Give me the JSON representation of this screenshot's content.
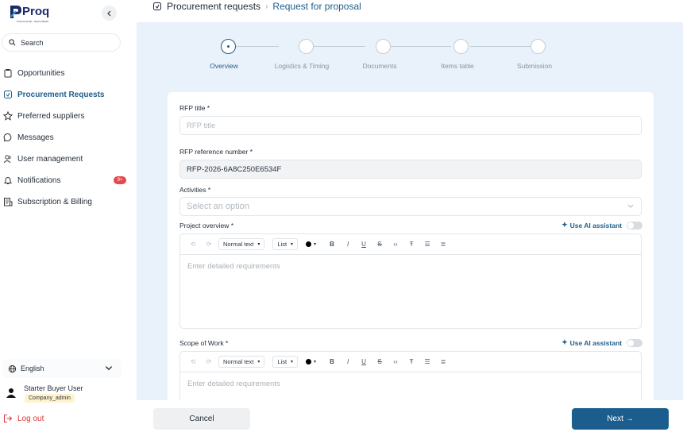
{
  "brand": {
    "name": "Proq",
    "tagline": "Procure Smart · Source Better"
  },
  "sidebar": {
    "search_label": "Search",
    "items": [
      {
        "label": "Opportunities",
        "icon": "clipboard-icon",
        "active": false
      },
      {
        "label": "Procurement Requests",
        "icon": "request-icon",
        "active": true
      },
      {
        "label": "Preferred suppliers",
        "icon": "star-icon",
        "active": false
      },
      {
        "label": "Messages",
        "icon": "chat-icon",
        "active": false
      },
      {
        "label": "User management",
        "icon": "users-icon",
        "active": false
      },
      {
        "label": "Notifications",
        "icon": "bell-icon",
        "active": false,
        "badge": "9+"
      },
      {
        "label": "Subscription & Billing",
        "icon": "billing-icon",
        "active": false
      }
    ],
    "language": "English",
    "user": {
      "name": "Starter Buyer User",
      "role": "Company_admin"
    },
    "logout_label": "Log out"
  },
  "breadcrumb": {
    "parent": "Procurement requests",
    "current": "Request for proposal"
  },
  "stepper": {
    "steps": [
      "Overview",
      "Logistics & Timing",
      "Documents",
      "Items table",
      "Submission"
    ],
    "active_index": 0
  },
  "form": {
    "rfp_title": {
      "label": "RFP title *",
      "placeholder": "RFP title"
    },
    "rfp_ref": {
      "label": "RFP reference number *",
      "value": "RFP-2026-6A8C250E6534F"
    },
    "activities": {
      "label": "Activities *",
      "placeholder": "Select an option"
    },
    "project_overview": {
      "label": "Project overview *",
      "placeholder": "Enter detailed requirements"
    },
    "scope_of_work": {
      "label": "Scope of Work *",
      "placeholder": "Enter detailed requirements"
    },
    "ai_assistant_label": "Use AI assistant",
    "toolbar": {
      "text_style": "Normal text",
      "list": "List"
    }
  },
  "footer": {
    "cancel_label": "Cancel",
    "next_label": "Next →"
  },
  "colors": {
    "accent": "#1e5e8c",
    "canvas": "#e9f1fa",
    "danger": "#d93b3b",
    "badge": "#e5484d"
  }
}
